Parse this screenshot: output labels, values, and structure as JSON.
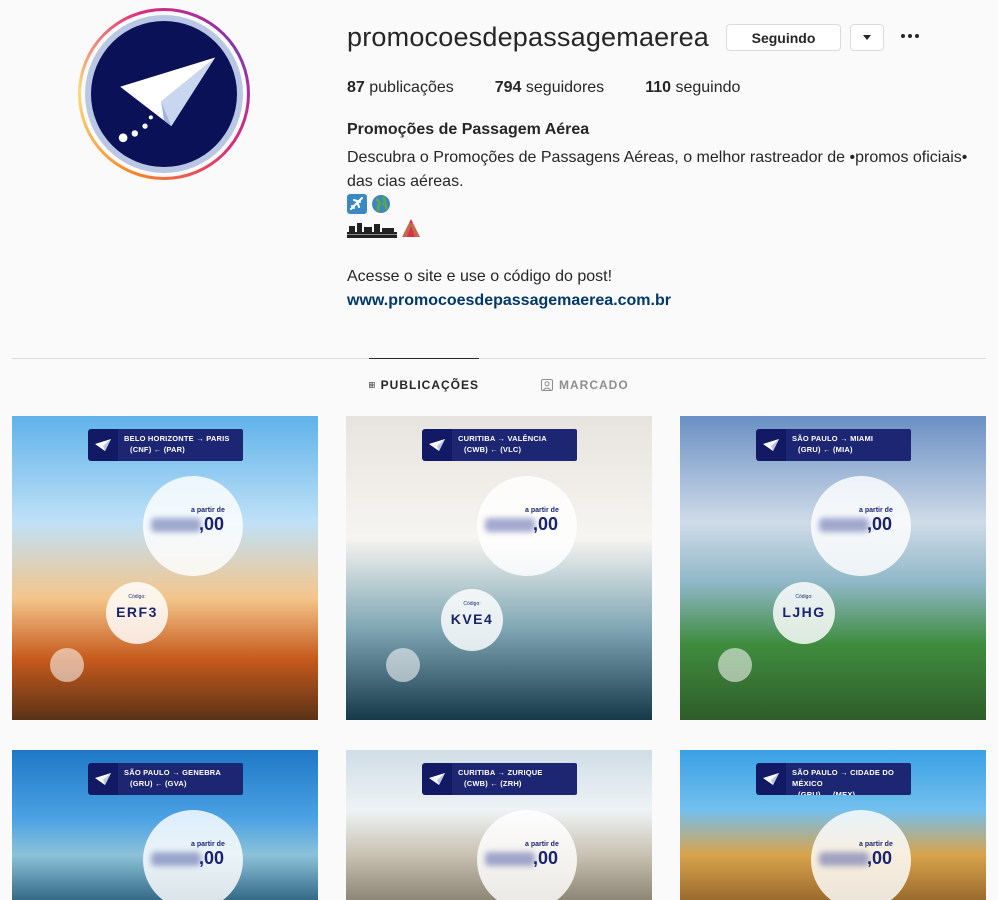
{
  "profile": {
    "username": "promocoesdepassagemaerea",
    "follow_button": "Seguindo",
    "stats": {
      "posts_count": "87",
      "posts_label": "publicações",
      "followers_count": "794",
      "followers_label": "seguidores",
      "following_count": "110",
      "following_label": "seguindo"
    },
    "full_name": "Promoções de Passagem Aérea",
    "bio": "Descubra o Promoções de Passagens Aéreas, o melhor rastreador de •promos oficiais• das cias aéreas.",
    "emoji_line_1": "✈️🌍",
    "emoji_line_2": "🏙️🌋",
    "cta": "Acesse o site e use o código do post!",
    "website": "www.promocoesdepassagemaerea.com.br"
  },
  "tabs": [
    {
      "label": "PUBLICAÇÕES",
      "icon": "grid-icon",
      "active": true
    },
    {
      "label": "MARCADO",
      "icon": "tagged-icon",
      "active": false
    }
  ],
  "posts": [
    {
      "from": "BELO HORIZONTE",
      "to": "PARIS",
      "from_code": "(CNF)",
      "to_code": "(PAR)",
      "price_label": "a partir de",
      "price_cents": ",00",
      "code_label": "Código:",
      "code": "ERF3"
    },
    {
      "from": "CURITIBA",
      "to": "VALÊNCIA",
      "from_code": "(CWB)",
      "to_code": "(VLC)",
      "price_label": "a partir de",
      "price_cents": ",00",
      "code_label": "Código:",
      "code": "KVE4"
    },
    {
      "from": "SÃO PAULO",
      "to": "MIAMI",
      "from_code": "(GRU)",
      "to_code": "(MIA)",
      "price_label": "a partir de",
      "price_cents": ",00",
      "code_label": "Código:",
      "code": "LJHG"
    },
    {
      "from": "SÃO PAULO",
      "to": "GENEBRA",
      "from_code": "(GRU)",
      "to_code": "(GVA)",
      "price_label": "a partir de",
      "price_cents": ",00"
    },
    {
      "from": "CURITIBA",
      "to": "ZURIQUE",
      "from_code": "(CWB)",
      "to_code": "(ZRH)",
      "price_label": "a partir de",
      "price_cents": ",00"
    },
    {
      "from": "SÃO PAULO",
      "to": "CIDADE DO MÉXICO",
      "from_code": "(GRU)",
      "to_code": "(MEX)",
      "price_label": "a partir de",
      "price_cents": ",00"
    }
  ],
  "arrows": {
    "right": "→",
    "left": "←"
  },
  "colors": {
    "brand_navy": "#0b1157",
    "link": "#00376b",
    "tag_bg": "#1d2673"
  }
}
